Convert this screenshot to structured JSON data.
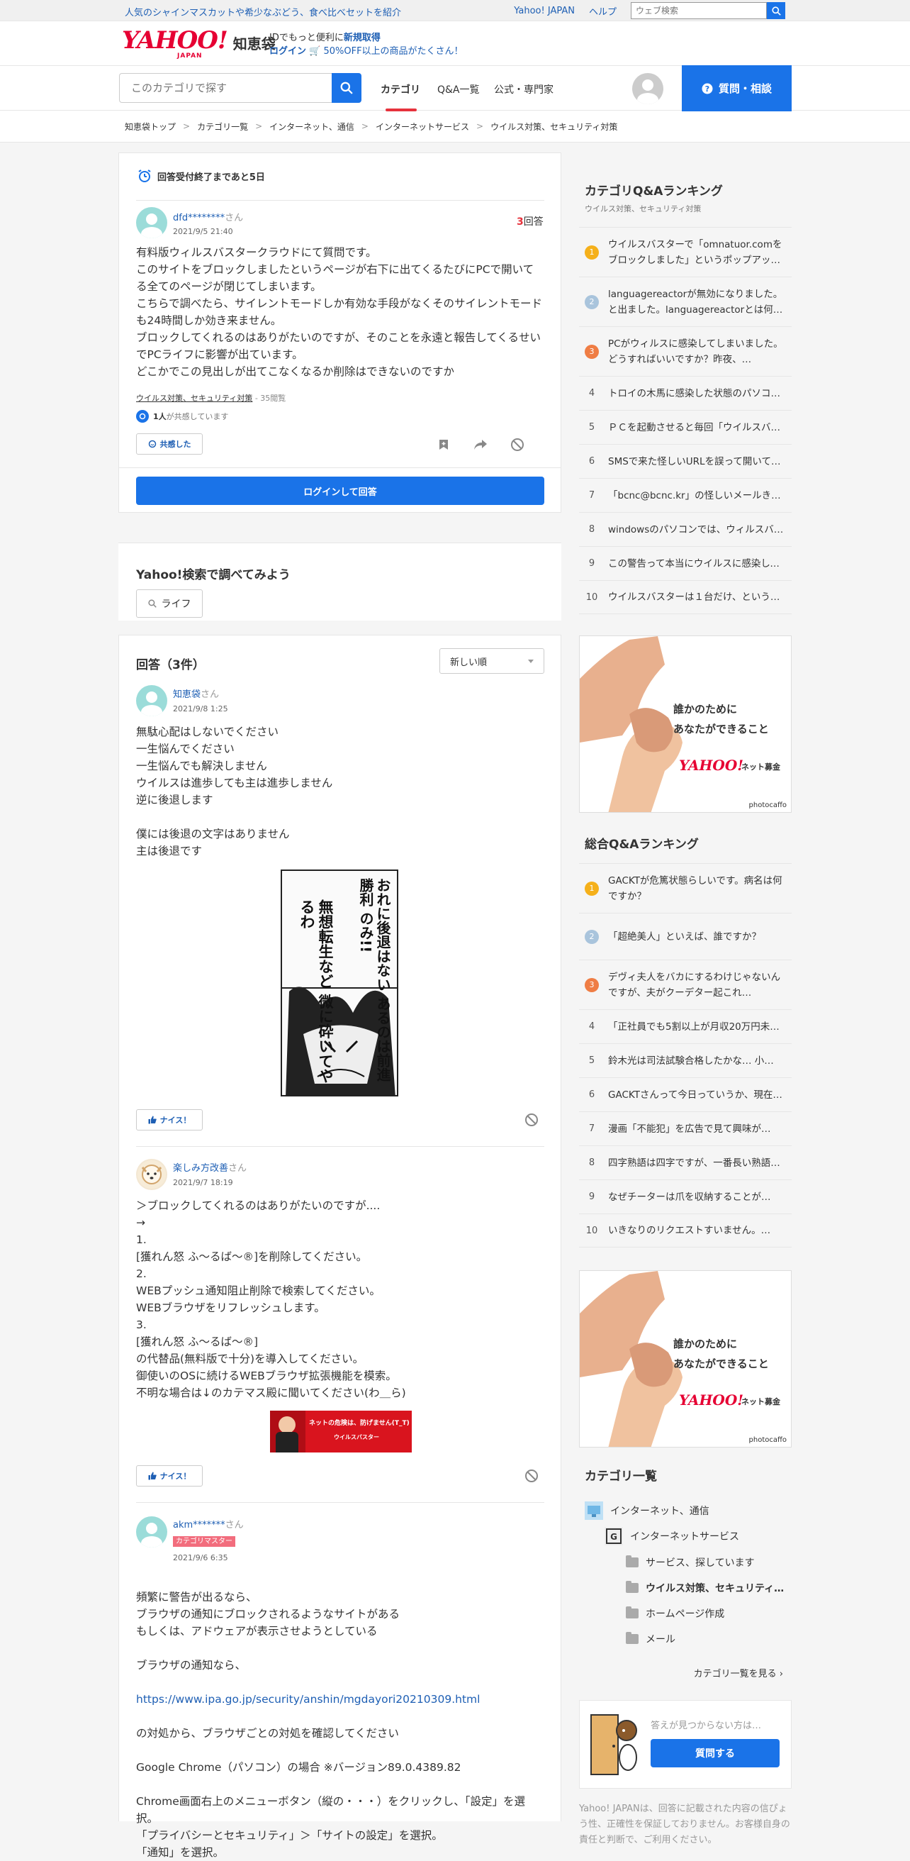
{
  "promo": {
    "text": "人気のシャインマスカットや希少なぶどう、食べ比べセットを紹介",
    "links": [
      "Yahoo! JAPAN",
      "ヘルプ"
    ],
    "search_placeholder": "ウェブ検索"
  },
  "logo": {
    "yahoo": "YAHOO!",
    "japan": "JAPAN",
    "service": "知恵袋",
    "promo_line1_prefix": "IDでもっと便利に",
    "promo_line1_link": "新規取得",
    "promo_line2_login": "ログイン",
    "promo_line2_text": "🛒 50%OFF以上の商品がたくさん！"
  },
  "nav": {
    "search_placeholder": "このカテゴリで探す",
    "tabs": [
      "カテゴリ",
      "Q&A一覧",
      "公式・専門家"
    ],
    "ask_button": "質問・相談"
  },
  "breadcrumb": [
    "知恵袋トップ",
    "カテゴリ一覧",
    "インターネット、通信",
    "インターネットサービス",
    "ウイルス対策、セキュリティ対策"
  ],
  "question": {
    "deadline": "回答受付終了まであと5日",
    "user": "dfd********",
    "san": "さん",
    "date": "2021/9/5 21:40",
    "answer_count": "3",
    "answer_count_label": "回答",
    "body": "有料版ウィルスバスタークラウドにて質問です。\nこのサイトをブロックしましたというページが右下に出てくるたびにPCで開いてる全てのページが閉じてしまいます。\nこちらで調べたら、サイレントモードしか有効な手段がなくそのサイレントモードも24時間しか効き来ません。\nブロックしてくれるのはありがたいのですが、そのことを永遠と報告してくるせいでPCライフに影響が出ています。\nどこかでこの見出しが出てこなくなるか削除はできないのですか",
    "category": "ウイルス対策、セキュリティ対策",
    "views": " - 35閲覧",
    "empathy_count": "1人",
    "empathy_suffix": "が共感しています",
    "empathize_button": "共感した",
    "login_answer_button": "ログインして回答"
  },
  "search_suggest": {
    "title": "Yahoo!検索で調べてみよう",
    "chip": "ライフ"
  },
  "answers": {
    "title": "回答（3件）",
    "sort": "新しい順",
    "nice_label": "ナイス！",
    "items": [
      {
        "user": "知恵袋",
        "san": "さん",
        "date": "2021/9/8 1:25",
        "body": "無駄心配はしないでください\n一生悩んでください\n一生悩んでも解決しません\nウイルスは進歩しても主は進歩しません\n逆に後退します\n\n僕には後退の文字はありません\n主は後退です"
      },
      {
        "user": "楽しみ方改善",
        "san": "さん",
        "date": "2021/9/7 18:19",
        "body": "＞ブロックしてくれるのはありがたいのですが....\n→\n1.\n[獲れん怒 ふ～るば～®]を削除してください。\n2.\nWEBプッシュ通知阻止削除で検索してください。\nWEBブラウザをリフレッシュします。\n3.\n[獲れん怒 ふ～るば～®]\nの代替品(無料版で十分)を導入してください。\n御使いのOSに続けるWEBブラウザ拡張機能を模索。\n不明な場合は↓のカテマス殿に聞いてください(わ＿ら)"
      },
      {
        "user": "akm*******",
        "san": "さん",
        "badge": "カテゴリマスター",
        "date": "2021/9/6 6:35",
        "body_1": "頻繁に警告が出るなら、\nブラウザの通知にブロックされるようなサイトがある\nもしくは、アドウェアが表示させようとしている\n\nブラウザの通知なら、",
        "link": "https://www.ipa.go.jp/security/anshin/mgdayori20210309.html",
        "body_2": "の対処から、ブラウザごとの対処を確認してください\n\nGoogle Chrome（パソコン）の場合 ※バージョン89.0.4389.82\n\nChrome画面右上のメニューボタン（縦の・・・）をクリックし、「設定」を選択。\n「プライバシーとセキュリティ」＞「サイトの設定」を選択。\n「通知」を選択。"
      }
    ]
  },
  "manga": {
    "line1": "おれに後退はない",
    "line2": "あるのは前進勝利",
    "line3": "のみ!!",
    "line4": "無想転生など",
    "line5": "微に砕いてやるわ"
  },
  "banner": {
    "line1": "ネットの危険は、防げません(T_T)",
    "line2": "ウイルスバスター"
  },
  "ranking_category": {
    "title": "カテゴリQ&Aランキング",
    "subtitle": "ウイルス対策、セキュリティ対策",
    "items": [
      "ウイルスバスターで「omnatuor.comをブロックしました」というポップアップ…",
      "languagereactorが無効になりました。と出ました。languagereactorとは何…",
      "PCがウィルスに感染してしまいました。どうすればいいですか？昨夜、…",
      "トロイの木馬に感染した状態のパソコン…",
      "ＰＣを起動させると毎回「ウイルスバスター…",
      "SMSで来た怪しいURLを誤って開いてしまいました…",
      "「bcnc@bcnc.kr」の怪しいメールきました…",
      "windowsのパソコンでは、ウィルスバスター…",
      "この警告って本当にウイルスに感染してますか…",
      "ウイルスバスターは１台だけ、という契約…"
    ]
  },
  "ranking_overall": {
    "title": "総合Q&Aランキング",
    "items": [
      "GACKTが危篤状態らしいです。病名は何ですか？",
      "「超絶美人」といえば、誰ですか？",
      "デヴィ夫人をバカにするわけじゃないんですが、夫がクーデター起これ…",
      "「正社員でも5割以上が月収20万円未満…",
      "鈴木光は司法試験合格したかな… 小…",
      "GACKTさんって今日っていうか、現在…",
      "漫画「不能犯」を広告で見て興味が…",
      "四字熟語は四字ですが、一番長い熟語…",
      "なぜチーターは爪を収納することが…",
      "いきなりのリクエストすいません。…"
    ]
  },
  "ad": {
    "line1": "誰かのために",
    "line2": "あなたができること",
    "logo": "YAHOO!",
    "logo_sub": "ネット募金",
    "credit": "photocaffo"
  },
  "category_list": {
    "title": "カテゴリ一覧",
    "items": [
      "インターネット、通信",
      "インターネットサービス",
      "サービス、探しています",
      "ウイルス対策、セキュリティ…",
      "ホームページ作成",
      "メール"
    ],
    "more": "カテゴリ一覧を見る ›"
  },
  "ask_box": {
    "text": "答えが見つからない方は…",
    "button": "質問する"
  },
  "disclaimer": "Yahoo! JAPANは、回答に記載された内容の信ぴょう性、正確性を保証しておりません。お客様自身の責任と判断で、ご利用ください。",
  "colors": {
    "accent": "#1a73e8",
    "link": "#1e5fb4",
    "brand": "#e60033"
  }
}
